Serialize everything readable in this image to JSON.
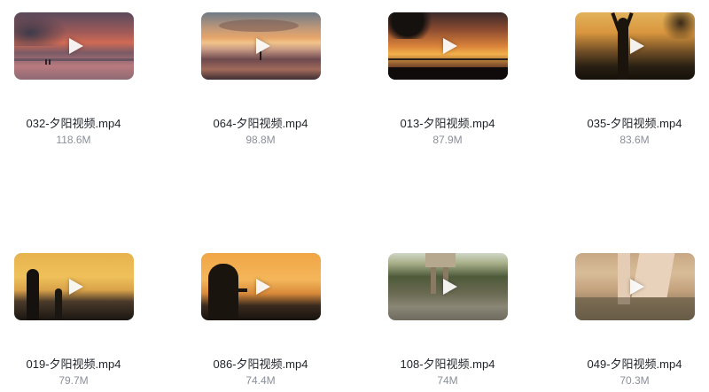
{
  "videos": [
    {
      "name": "032-夕阳视频.mp4",
      "size": "118.6M"
    },
    {
      "name": "064-夕阳视频.mp4",
      "size": "98.8M"
    },
    {
      "name": "013-夕阳视频.mp4",
      "size": "87.9M"
    },
    {
      "name": "035-夕阳视频.mp4",
      "size": "83.6M"
    },
    {
      "name": "019-夕阳视频.mp4",
      "size": "79.7M"
    },
    {
      "name": "086-夕阳视频.mp4",
      "size": "74.4M"
    },
    {
      "name": "108-夕阳视频.mp4",
      "size": "74M"
    },
    {
      "name": "049-夕阳视频.mp4",
      "size": "70.3M"
    }
  ],
  "icons": {
    "play": "play-icon"
  }
}
